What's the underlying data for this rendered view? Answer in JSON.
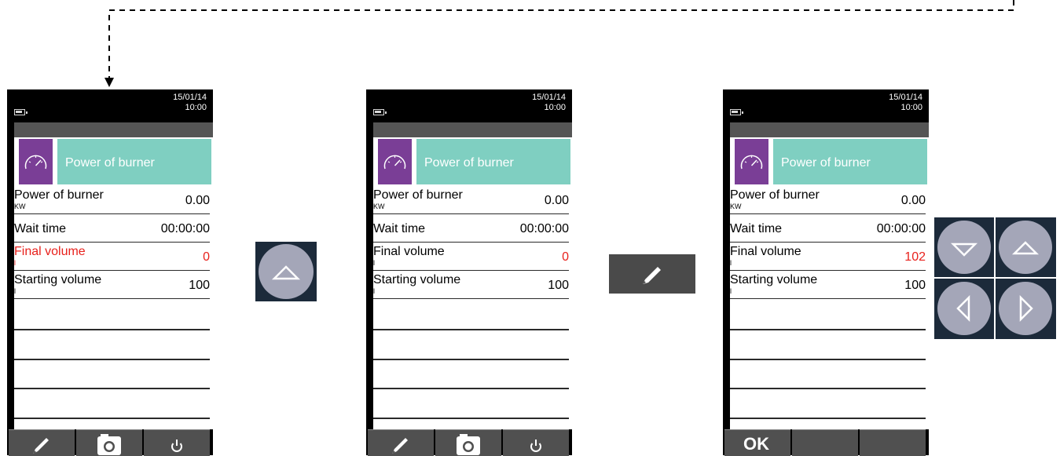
{
  "screens": [
    {
      "date": "15/01/14",
      "time": "10:00",
      "header_title": "Power of burner",
      "rows": [
        {
          "label": "Power of burner",
          "unit": "KW",
          "value": "0.00"
        },
        {
          "label": "Wait time",
          "unit": "",
          "value": "00:00:00"
        },
        {
          "label": "Final volume",
          "unit": "l",
          "value": "0"
        },
        {
          "label": "Starting volume",
          "unit": "l",
          "value": "100"
        }
      ],
      "bottom_buttons": [
        "pencil-icon",
        "camera-icon",
        "power-icon"
      ]
    },
    {
      "date": "15/01/14",
      "time": "10:00",
      "header_title": "Power of burner",
      "rows": [
        {
          "label": "Power of burner",
          "unit": "KW",
          "value": "0.00"
        },
        {
          "label": "Wait time",
          "unit": "",
          "value": "00:00:00"
        },
        {
          "label": "Final volume",
          "unit": "l",
          "value": "0"
        },
        {
          "label": "Starting volume",
          "unit": "l",
          "value": "100"
        }
      ],
      "bottom_buttons": [
        "pencil-icon",
        "camera-icon",
        "power-icon"
      ]
    },
    {
      "date": "15/01/14",
      "time": "10:00",
      "header_title": "Power of burner",
      "rows": [
        {
          "label": "Power of burner",
          "unit": "KW",
          "value": "0.00"
        },
        {
          "label": "Wait time",
          "unit": "",
          "value": "00:00:00"
        },
        {
          "label": "Final volume",
          "unit": "l",
          "value": "102"
        },
        {
          "label": "Starting volume",
          "unit": "l",
          "value": "100"
        }
      ],
      "bottom_buttons": [
        "OK",
        "",
        ""
      ]
    }
  ],
  "colors": {
    "accent_teal": "#7fcfc1",
    "icon_purple": "#7a3e96",
    "highlight_red": "#e8211c",
    "key_panel": "#1c2a3a",
    "key_circle": "#a4a6b8"
  },
  "keys": [
    "up-arrow-key",
    "pencil-key",
    "down-arrow-key",
    "up-arrow-key",
    "left-arrow-key",
    "right-arrow-key"
  ]
}
